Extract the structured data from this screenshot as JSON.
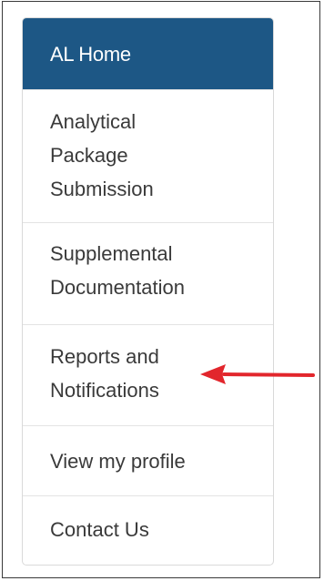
{
  "sidebar": {
    "items": [
      {
        "label": "AL Home",
        "active": true
      },
      {
        "label": "Analytical Package Submission"
      },
      {
        "label": "Supplemental Documentation"
      },
      {
        "label": "Reports and Notifications"
      },
      {
        "label": "View my profile"
      },
      {
        "label": "Contact Us"
      }
    ]
  },
  "annotation": {
    "arrow_color": "#e2262c",
    "icon": "left-arrow-icon"
  },
  "colors": {
    "active_bg": "#1d5785",
    "text": "#3a3a3a"
  }
}
